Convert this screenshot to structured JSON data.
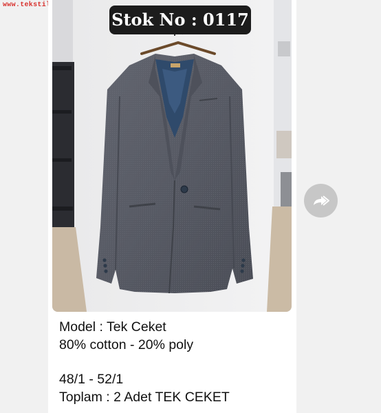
{
  "watermark": "www.tekstilportal.com",
  "stock_badge": "Stok No : 0117",
  "caption": {
    "model": "Model : Tek Ceket",
    "fabric": "80% cotton - 20% poly",
    "sizes": "48/1 - 52/1",
    "total": "Toplam : 2 Adet TEK CEKET"
  },
  "icons": {
    "share": "forward-share-icon"
  },
  "colors": {
    "background": "#f1f1f1",
    "card": "#ffffff",
    "badge": "#1c1c1c",
    "watermark": "#d8322e",
    "share_button": "#c7c7c7"
  }
}
